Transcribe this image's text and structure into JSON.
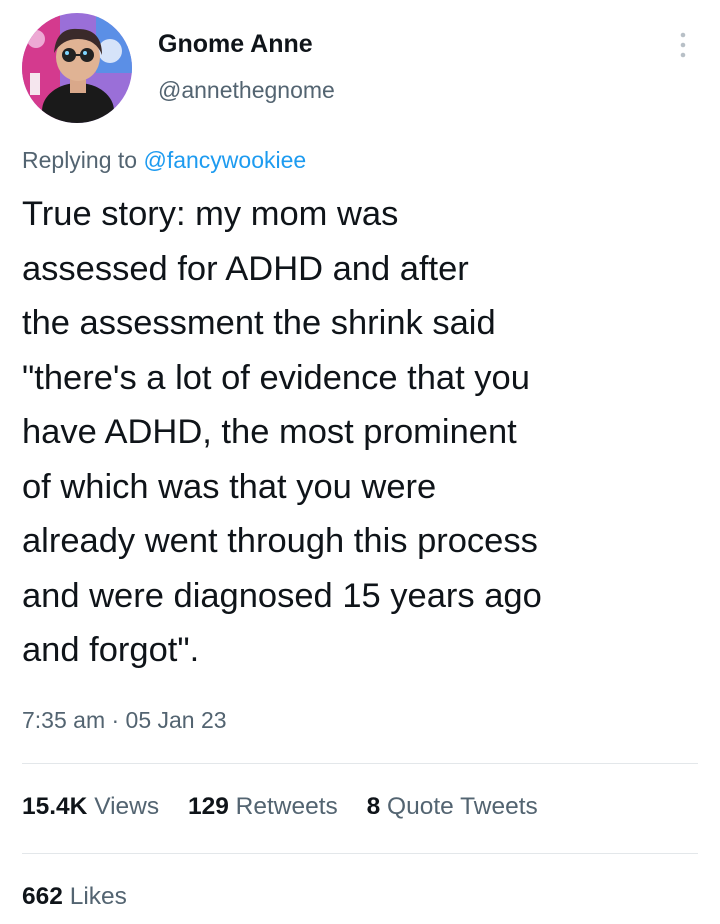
{
  "author": {
    "display_name": "Gnome Anne",
    "handle": "@annethegnome"
  },
  "reply": {
    "prefix": "Replying to ",
    "mention": "@fancywookiee"
  },
  "tweet": {
    "lines": [
      "True story: my mom was",
      "assessed for ADHD and after",
      "the assessment the shrink said",
      "\"there's a lot of evidence that you",
      "have ADHD, the most prominent",
      "of which was that you were",
      "already went through this process",
      "and were diagnosed 15 years ago",
      "and forgot\"."
    ],
    "timestamp": "7:35 am · 05 Jan 23"
  },
  "stats": {
    "views": {
      "count": "15.4K",
      "label": "Views"
    },
    "retweets": {
      "count": "129",
      "label": "Retweets"
    },
    "quotes": {
      "count": "8",
      "label": "Quote Tweets"
    },
    "likes": {
      "count": "662",
      "label": "Likes"
    }
  },
  "colors": {
    "text": "#0f1419",
    "secondary": "#536471",
    "link": "#1d9bf0",
    "divider": "#e3e7ea"
  },
  "icons": {
    "more": "more-vertical-icon"
  }
}
